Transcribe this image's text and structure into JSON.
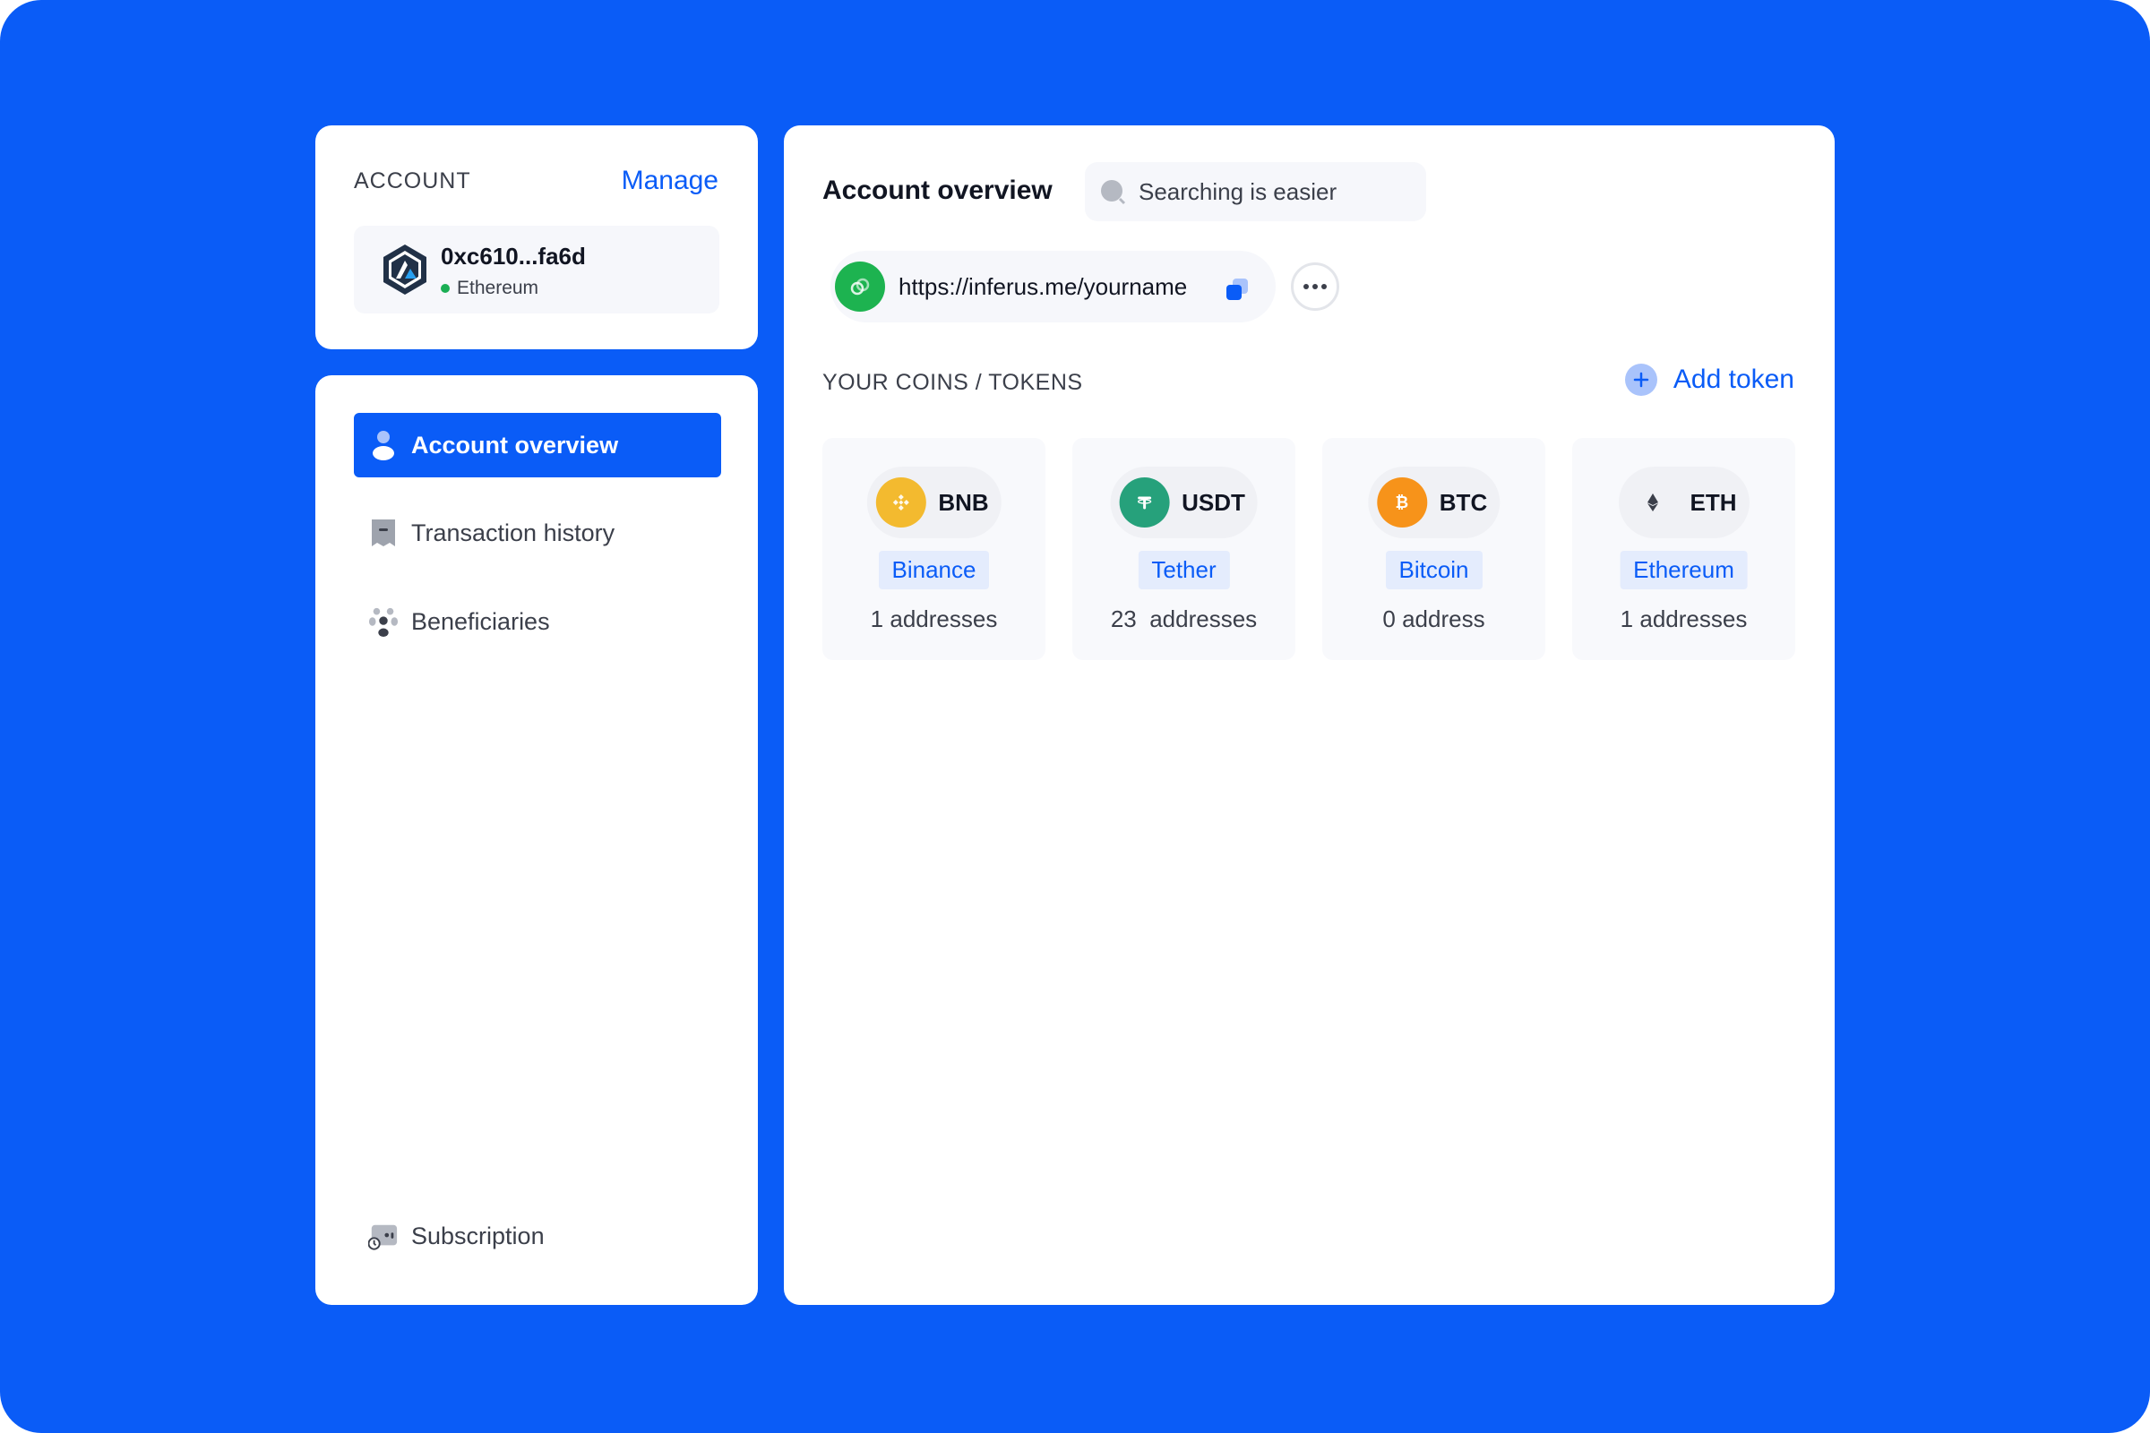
{
  "account": {
    "label": "ACCOUNT",
    "manage_label": "Manage",
    "wallet_address": "0xc610...fa6d",
    "network": "Ethereum"
  },
  "nav": {
    "items": [
      {
        "label": "Account overview",
        "icon": "user-icon",
        "active": true
      },
      {
        "label": "Transaction history",
        "icon": "receipt-icon",
        "active": false
      },
      {
        "label": "Beneficiaries",
        "icon": "people-icon",
        "active": false
      },
      {
        "label": "Subscription",
        "icon": "wallet-clock-icon",
        "active": false
      }
    ]
  },
  "main": {
    "title": "Account overview",
    "search_placeholder": "Searching is easier",
    "profile_link": "https://inferus.me/yourname",
    "section_label": "YOUR COINS / TOKENS",
    "add_token_label": "Add token",
    "tokens": [
      {
        "symbol": "BNB",
        "name": "Binance",
        "count": "1 addresses",
        "color": "#f3ba2f"
      },
      {
        "symbol": "USDT",
        "name": "Tether",
        "count": "23  addresses",
        "color": "#26a17b"
      },
      {
        "symbol": "BTC",
        "name": "Bitcoin",
        "count": "0 address",
        "color": "#f7931a"
      },
      {
        "symbol": "ETH",
        "name": "Ethereum",
        "count": "1 addresses",
        "color": "#f0f1f5"
      }
    ]
  },
  "colors": {
    "background": "#0a5cf7",
    "accent": "#0a5cf7",
    "success": "#1aae54"
  }
}
